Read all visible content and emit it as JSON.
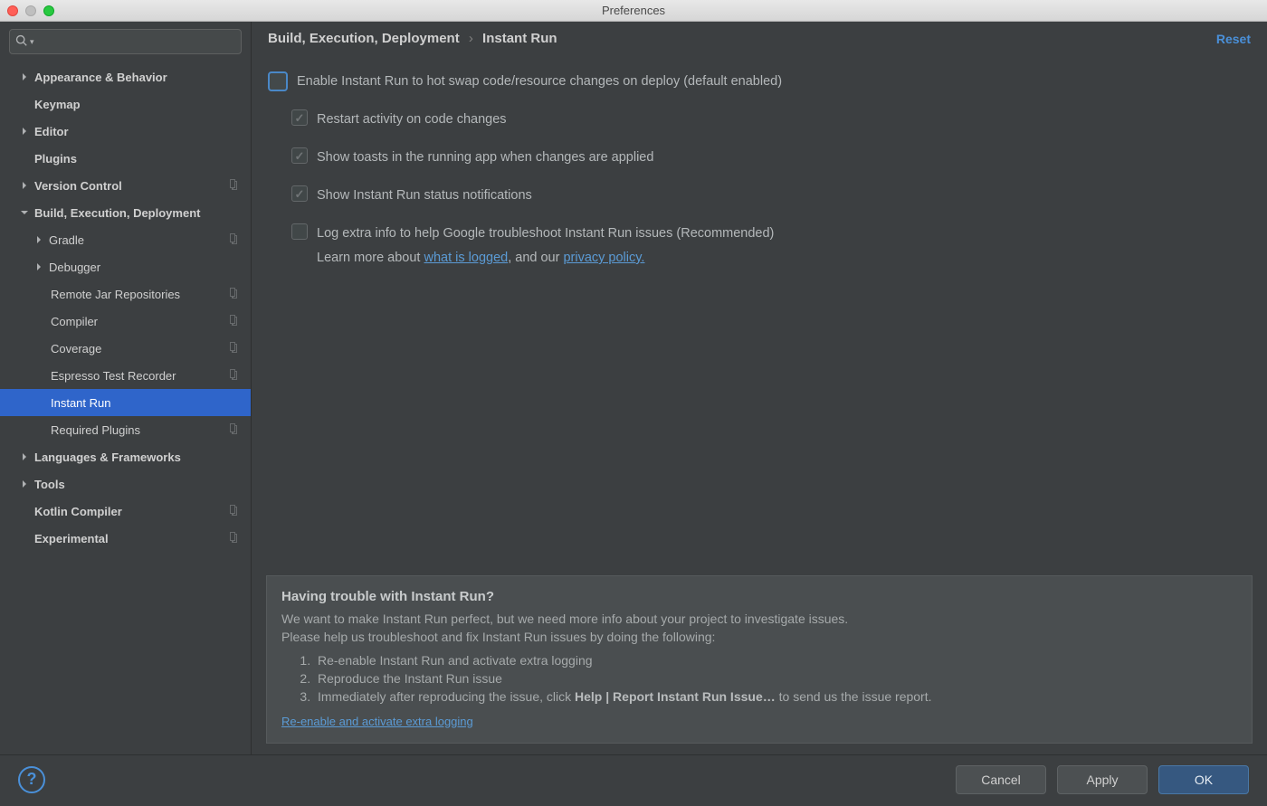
{
  "window": {
    "title": "Preferences"
  },
  "breadcrumb": {
    "parent": "Build, Execution, Deployment",
    "current": "Instant Run"
  },
  "reset_label": "Reset",
  "sidebar": {
    "search_placeholder": "",
    "items": [
      {
        "label": "Appearance & Behavior"
      },
      {
        "label": "Keymap"
      },
      {
        "label": "Editor"
      },
      {
        "label": "Plugins"
      },
      {
        "label": "Version Control"
      },
      {
        "label": "Build, Execution, Deployment"
      },
      {
        "label": "Gradle"
      },
      {
        "label": "Debugger"
      },
      {
        "label": "Remote Jar Repositories"
      },
      {
        "label": "Compiler"
      },
      {
        "label": "Coverage"
      },
      {
        "label": "Espresso Test Recorder"
      },
      {
        "label": "Instant Run"
      },
      {
        "label": "Required Plugins"
      },
      {
        "label": "Languages & Frameworks"
      },
      {
        "label": "Tools"
      },
      {
        "label": "Kotlin Compiler"
      },
      {
        "label": "Experimental"
      }
    ]
  },
  "options": {
    "enable_label": "Enable Instant Run to hot swap code/resource changes on deploy (default enabled)",
    "restart_label": "Restart activity on code changes",
    "toast_label": "Show toasts in the running app when changes are applied",
    "status_label": "Show Instant Run status notifications",
    "log_label": "Log extra info to help Google troubleshoot Instant Run issues (Recommended)",
    "learn_prefix": "Learn more about ",
    "learn_link1": "what is logged",
    "learn_mid": ", and our ",
    "learn_link2": "privacy policy."
  },
  "help": {
    "title": "Having trouble with Instant Run?",
    "line1": "We want to make Instant Run perfect, but we need more info about your project to investigate issues.",
    "line2": "Please help us troubleshoot and fix Instant Run issues by doing the following:",
    "step1": "Re-enable Instant Run and activate extra logging",
    "step2": "Reproduce the Instant Run issue",
    "step3_a": "Immediately after reproducing the issue, click ",
    "step3_b": "Help | Report Instant Run Issue…",
    "step3_c": " to send us the issue report.",
    "action_link": "Re-enable and activate extra logging"
  },
  "footer": {
    "cancel": "Cancel",
    "apply": "Apply",
    "ok": "OK"
  }
}
